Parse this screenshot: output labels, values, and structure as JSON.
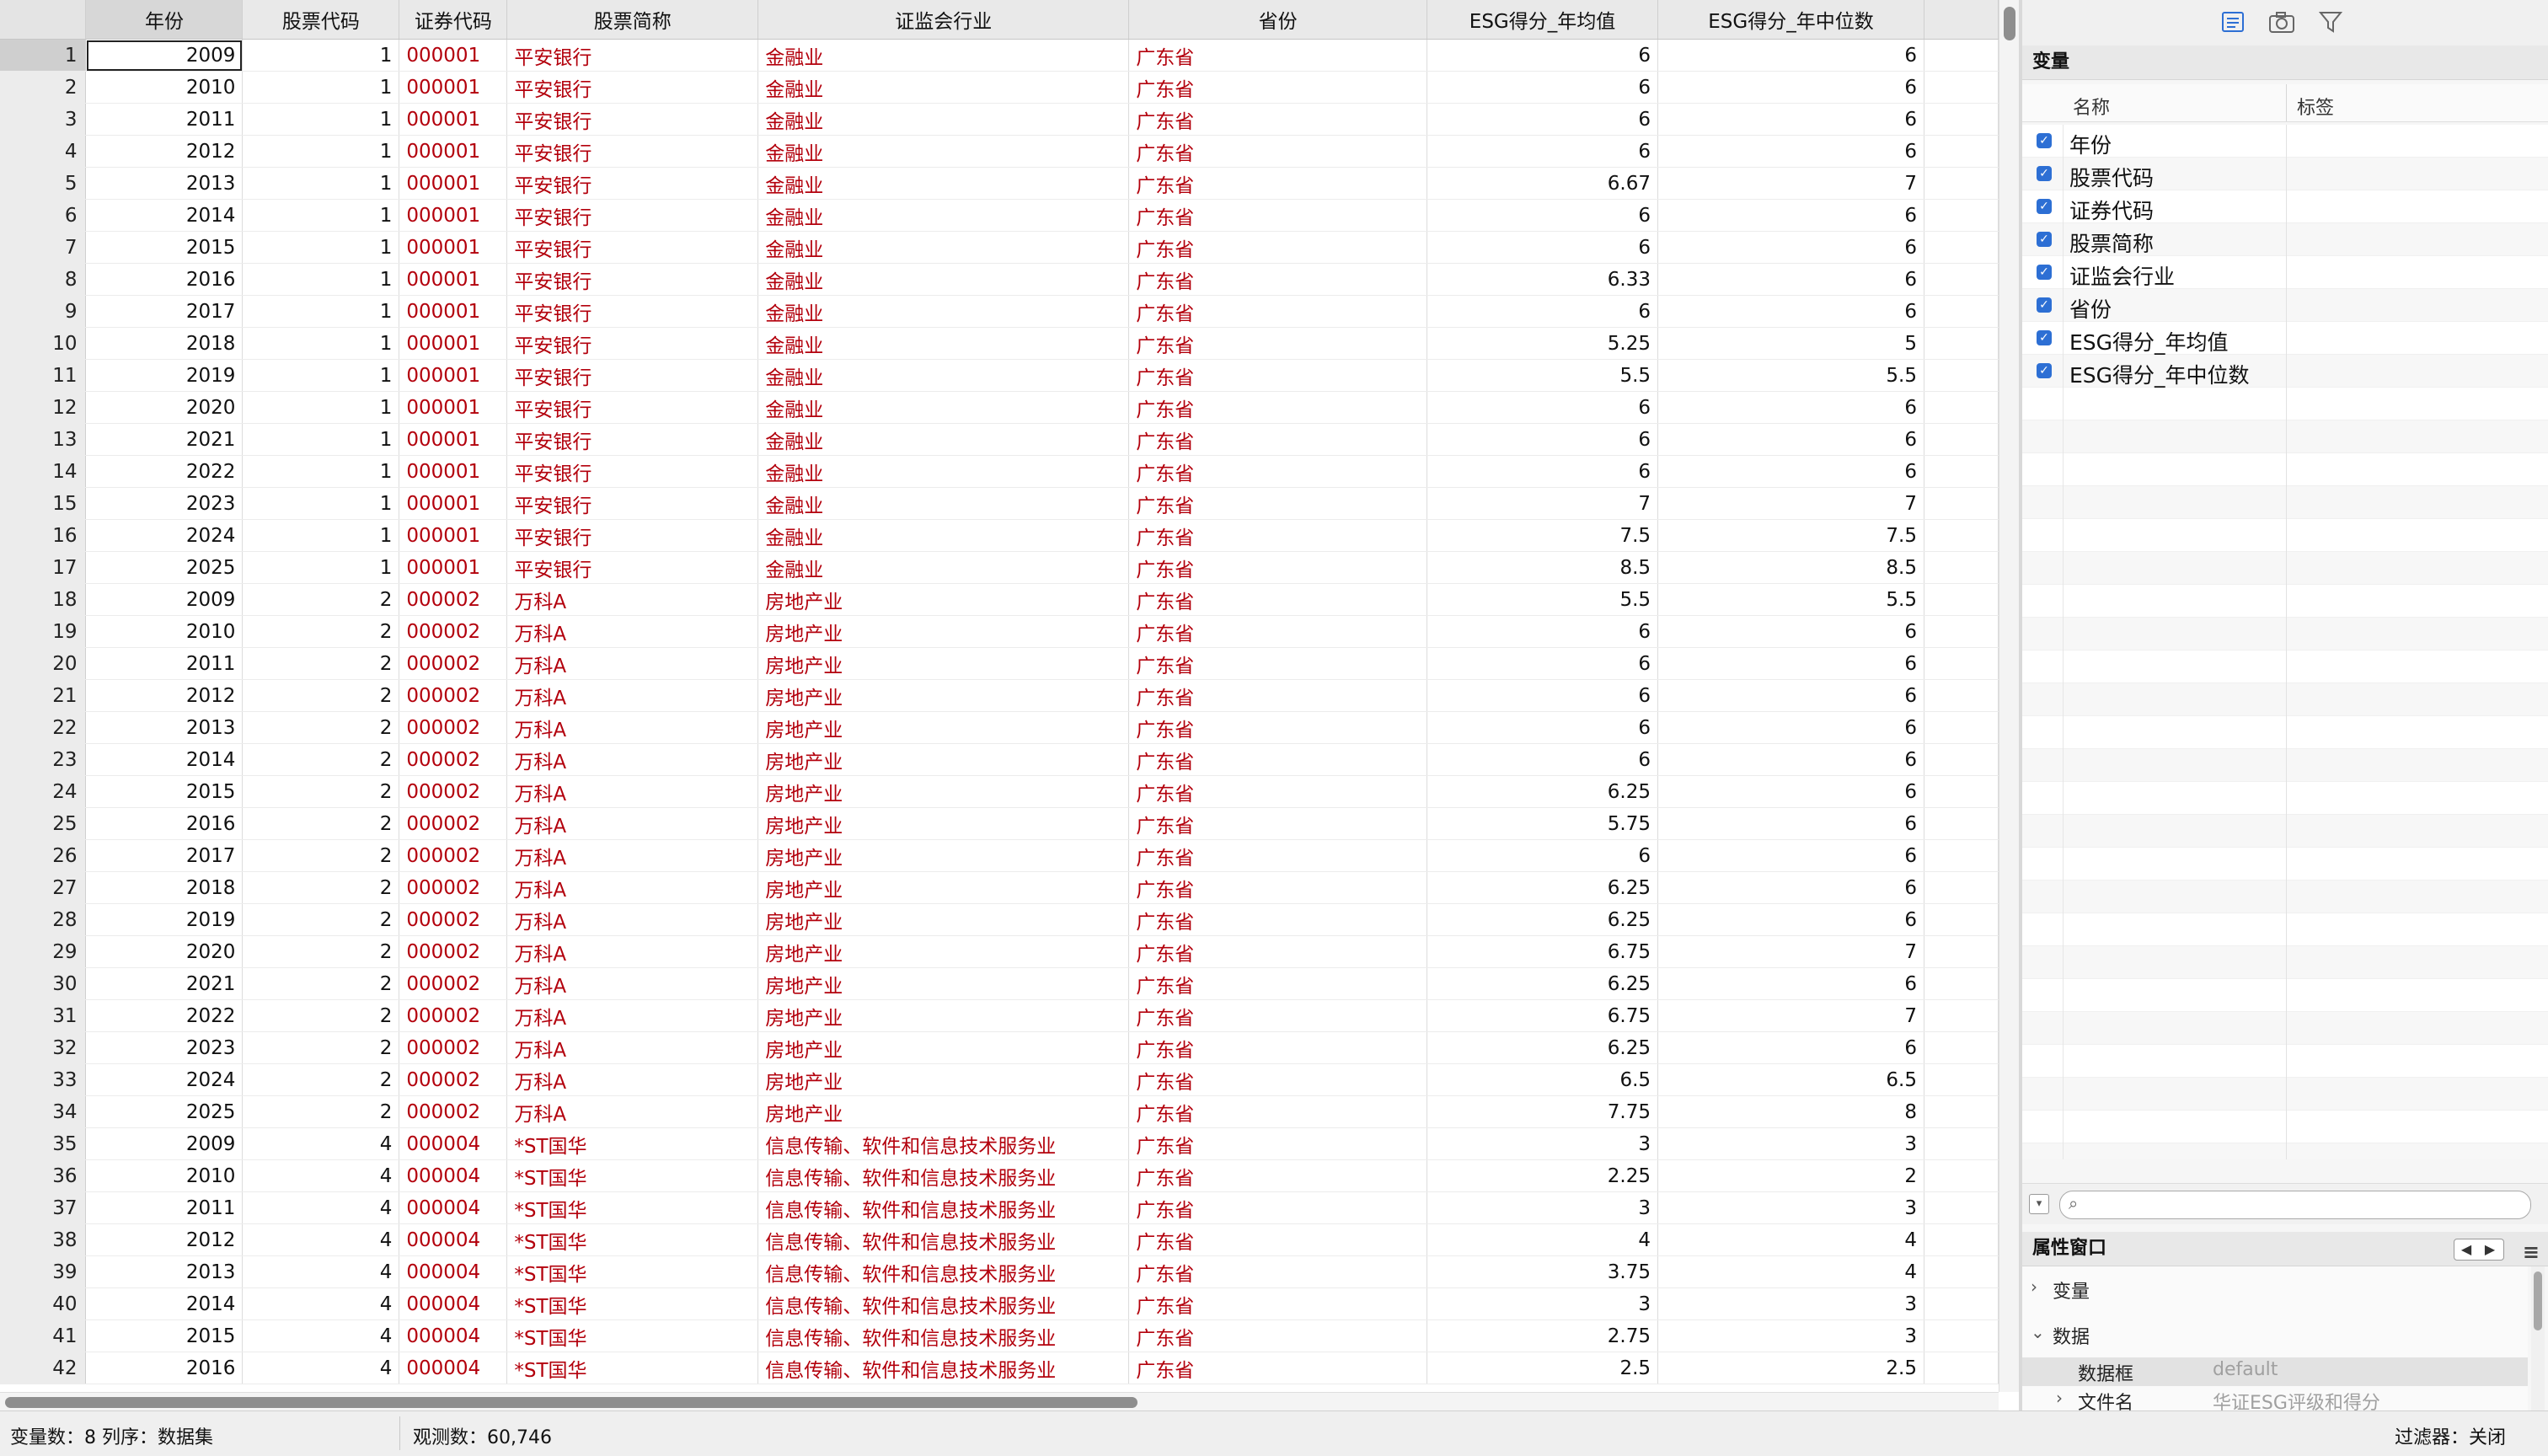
{
  "grid": {
    "columns": [
      "年份",
      "股票代码",
      "证券代码",
      "股票简称",
      "证监会行业",
      "省份",
      "ESG得分_年均值",
      "ESG得分_年中位数"
    ],
    "rows": [
      [
        "1",
        "2009",
        "1",
        "000001",
        "平安银行",
        "金融业",
        "广东省",
        "6",
        "6"
      ],
      [
        "2",
        "2010",
        "1",
        "000001",
        "平安银行",
        "金融业",
        "广东省",
        "6",
        "6"
      ],
      [
        "3",
        "2011",
        "1",
        "000001",
        "平安银行",
        "金融业",
        "广东省",
        "6",
        "6"
      ],
      [
        "4",
        "2012",
        "1",
        "000001",
        "平安银行",
        "金融业",
        "广东省",
        "6",
        "6"
      ],
      [
        "5",
        "2013",
        "1",
        "000001",
        "平安银行",
        "金融业",
        "广东省",
        "6.67",
        "7"
      ],
      [
        "6",
        "2014",
        "1",
        "000001",
        "平安银行",
        "金融业",
        "广东省",
        "6",
        "6"
      ],
      [
        "7",
        "2015",
        "1",
        "000001",
        "平安银行",
        "金融业",
        "广东省",
        "6",
        "6"
      ],
      [
        "8",
        "2016",
        "1",
        "000001",
        "平安银行",
        "金融业",
        "广东省",
        "6.33",
        "6"
      ],
      [
        "9",
        "2017",
        "1",
        "000001",
        "平安银行",
        "金融业",
        "广东省",
        "6",
        "6"
      ],
      [
        "10",
        "2018",
        "1",
        "000001",
        "平安银行",
        "金融业",
        "广东省",
        "5.25",
        "5"
      ],
      [
        "11",
        "2019",
        "1",
        "000001",
        "平安银行",
        "金融业",
        "广东省",
        "5.5",
        "5.5"
      ],
      [
        "12",
        "2020",
        "1",
        "000001",
        "平安银行",
        "金融业",
        "广东省",
        "6",
        "6"
      ],
      [
        "13",
        "2021",
        "1",
        "000001",
        "平安银行",
        "金融业",
        "广东省",
        "6",
        "6"
      ],
      [
        "14",
        "2022",
        "1",
        "000001",
        "平安银行",
        "金融业",
        "广东省",
        "6",
        "6"
      ],
      [
        "15",
        "2023",
        "1",
        "000001",
        "平安银行",
        "金融业",
        "广东省",
        "7",
        "7"
      ],
      [
        "16",
        "2024",
        "1",
        "000001",
        "平安银行",
        "金融业",
        "广东省",
        "7.5",
        "7.5"
      ],
      [
        "17",
        "2025",
        "1",
        "000001",
        "平安银行",
        "金融业",
        "广东省",
        "8.5",
        "8.5"
      ],
      [
        "18",
        "2009",
        "2",
        "000002",
        "万科A",
        "房地产业",
        "广东省",
        "5.5",
        "5.5"
      ],
      [
        "19",
        "2010",
        "2",
        "000002",
        "万科A",
        "房地产业",
        "广东省",
        "6",
        "6"
      ],
      [
        "20",
        "2011",
        "2",
        "000002",
        "万科A",
        "房地产业",
        "广东省",
        "6",
        "6"
      ],
      [
        "21",
        "2012",
        "2",
        "000002",
        "万科A",
        "房地产业",
        "广东省",
        "6",
        "6"
      ],
      [
        "22",
        "2013",
        "2",
        "000002",
        "万科A",
        "房地产业",
        "广东省",
        "6",
        "6"
      ],
      [
        "23",
        "2014",
        "2",
        "000002",
        "万科A",
        "房地产业",
        "广东省",
        "6",
        "6"
      ],
      [
        "24",
        "2015",
        "2",
        "000002",
        "万科A",
        "房地产业",
        "广东省",
        "6.25",
        "6"
      ],
      [
        "25",
        "2016",
        "2",
        "000002",
        "万科A",
        "房地产业",
        "广东省",
        "5.75",
        "6"
      ],
      [
        "26",
        "2017",
        "2",
        "000002",
        "万科A",
        "房地产业",
        "广东省",
        "6",
        "6"
      ],
      [
        "27",
        "2018",
        "2",
        "000002",
        "万科A",
        "房地产业",
        "广东省",
        "6.25",
        "6"
      ],
      [
        "28",
        "2019",
        "2",
        "000002",
        "万科A",
        "房地产业",
        "广东省",
        "6.25",
        "6"
      ],
      [
        "29",
        "2020",
        "2",
        "000002",
        "万科A",
        "房地产业",
        "广东省",
        "6.75",
        "7"
      ],
      [
        "30",
        "2021",
        "2",
        "000002",
        "万科A",
        "房地产业",
        "广东省",
        "6.25",
        "6"
      ],
      [
        "31",
        "2022",
        "2",
        "000002",
        "万科A",
        "房地产业",
        "广东省",
        "6.75",
        "7"
      ],
      [
        "32",
        "2023",
        "2",
        "000002",
        "万科A",
        "房地产业",
        "广东省",
        "6.25",
        "6"
      ],
      [
        "33",
        "2024",
        "2",
        "000002",
        "万科A",
        "房地产业",
        "广东省",
        "6.5",
        "6.5"
      ],
      [
        "34",
        "2025",
        "2",
        "000002",
        "万科A",
        "房地产业",
        "广东省",
        "7.75",
        "8"
      ],
      [
        "35",
        "2009",
        "4",
        "000004",
        "*ST国华",
        "信息传输、软件和信息技术服务业",
        "广东省",
        "3",
        "3"
      ],
      [
        "36",
        "2010",
        "4",
        "000004",
        "*ST国华",
        "信息传输、软件和信息技术服务业",
        "广东省",
        "2.25",
        "2"
      ],
      [
        "37",
        "2011",
        "4",
        "000004",
        "*ST国华",
        "信息传输、软件和信息技术服务业",
        "广东省",
        "3",
        "3"
      ],
      [
        "38",
        "2012",
        "4",
        "000004",
        "*ST国华",
        "信息传输、软件和信息技术服务业",
        "广东省",
        "4",
        "4"
      ],
      [
        "39",
        "2013",
        "4",
        "000004",
        "*ST国华",
        "信息传输、软件和信息技术服务业",
        "广东省",
        "3.75",
        "4"
      ],
      [
        "40",
        "2014",
        "4",
        "000004",
        "*ST国华",
        "信息传输、软件和信息技术服务业",
        "广东省",
        "3",
        "3"
      ],
      [
        "41",
        "2015",
        "4",
        "000004",
        "*ST国华",
        "信息传输、软件和信息技术服务业",
        "广东省",
        "2.75",
        "3"
      ],
      [
        "42",
        "2016",
        "4",
        "000004",
        "*ST国华",
        "信息传输、软件和信息技术服务业",
        "广东省",
        "2.5",
        "2.5"
      ]
    ]
  },
  "panel": {
    "toolbar_icons": [
      "variables-icon",
      "snapshot-camera-icon",
      "filter-funnel-icon"
    ],
    "variables_title": "变量",
    "col_name": "名称",
    "col_label": "标签",
    "variables": [
      "年份",
      "股票代码",
      "证券代码",
      "股票简称",
      "证监会行业",
      "省份",
      "ESG得分_年均值",
      "ESG得分_年中位数"
    ],
    "search_placeholder": "",
    "properties_title": "属性窗口",
    "prop_variable": "变量",
    "prop_data": "数据",
    "prop_frame_key": "数据框",
    "prop_frame_val": "default",
    "prop_file_key": "文件名",
    "prop_file_val": "华证ESG评级和得分"
  },
  "status": {
    "left": "变量数：8  列序：数据集",
    "middle": "观测数：60,746",
    "right": "过滤器：关闭"
  },
  "colors": {
    "string_text": "#b3000c",
    "checkbox": "#2d6fd4"
  }
}
